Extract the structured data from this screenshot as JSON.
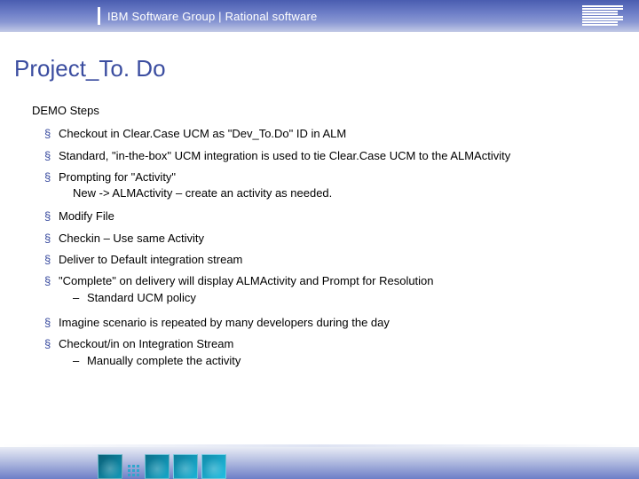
{
  "banner": {
    "title": "IBM Software Group | Rational software",
    "logo_name": "ibm-logo"
  },
  "slide": {
    "title": "Project_To. Do"
  },
  "content": {
    "heading": "DEMO Steps",
    "items": [
      {
        "text": "Checkout in Clear.Case UCM as \"Dev_To.Do\" ID in ALM"
      },
      {
        "text": "Standard, \"in-the-box\" UCM integration is used to tie Clear.Case UCM to the ALMActivity"
      },
      {
        "text": "Prompting for \"Activity\"",
        "sublines": [
          "New -> ALMActivity – create an activity as needed."
        ]
      },
      {
        "text": "Modify File"
      },
      {
        "text": "Checkin – Use same Activity"
      },
      {
        "text": "Deliver to Default integration stream"
      },
      {
        "text": "\"Complete\" on delivery will display ALMActivity and Prompt for Resolution",
        "dash_subs": [
          "Standard UCM policy"
        ]
      },
      {
        "text": "Imagine scenario is repeated by many developers during the day"
      },
      {
        "text": "Checkout/in on Integration Stream",
        "dash_subs": [
          "Manually complete the activity"
        ]
      }
    ]
  }
}
